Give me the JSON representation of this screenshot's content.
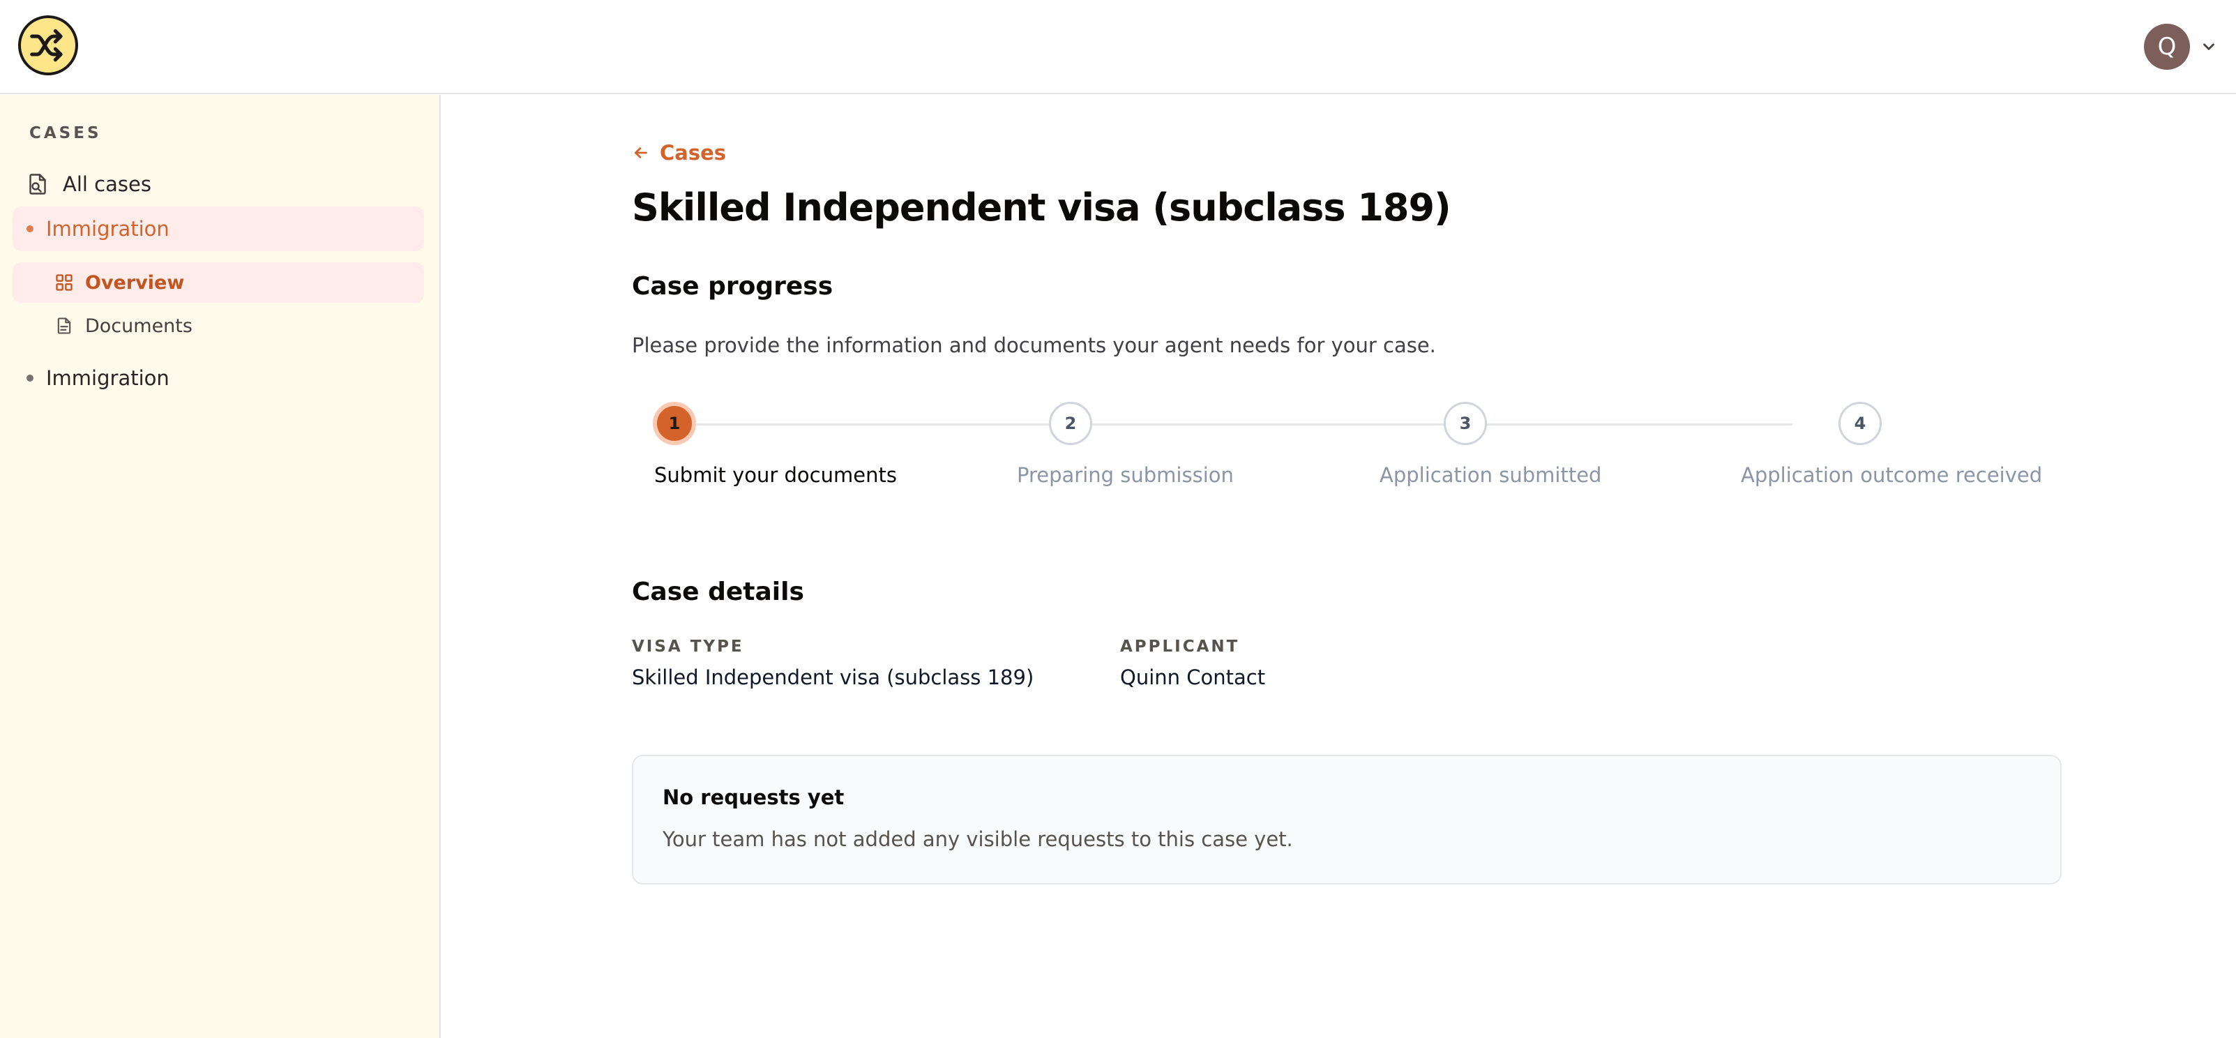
{
  "header": {
    "logo_icon": "shuffle-icon",
    "avatar_initial": "Q",
    "menu_icon": "chevron-down-icon"
  },
  "sidebar": {
    "heading": "CASES",
    "all_cases": {
      "label": "All cases",
      "icon": "document-search-icon"
    },
    "case_1": {
      "label": "Immigration",
      "active": true
    },
    "sub_items": [
      {
        "label": "Overview",
        "icon": "grid-icon",
        "active": true
      },
      {
        "label": "Documents",
        "icon": "file-icon",
        "active": false
      }
    ],
    "case_2": {
      "label": "Immigration",
      "active": false
    }
  },
  "main": {
    "back_label": "Cases",
    "title": "Skilled Independent visa (subclass 189)",
    "progress_heading": "Case progress",
    "intro": "Please provide the information and documents your agent needs for your case.",
    "steps": [
      {
        "number": "1",
        "label": "Submit your documents",
        "status": "current"
      },
      {
        "number": "2",
        "label": "Preparing submission",
        "status": "upcoming"
      },
      {
        "number": "3",
        "label": "Application submitted",
        "status": "upcoming"
      },
      {
        "number": "4",
        "label": "Application outcome received",
        "status": "upcoming"
      }
    ],
    "details_heading": "Case details",
    "details": [
      {
        "label": "VISA TYPE",
        "value": "Skilled Independent visa (subclass 189)"
      },
      {
        "label": "APPLICANT",
        "value": "Quinn Contact"
      }
    ],
    "empty_state": {
      "title": "No requests yet",
      "body": "Your team has not added any visible requests to this case yet."
    }
  },
  "colors": {
    "accent": "#d4622b",
    "sidebar_bg": "#fffaeb",
    "active_item_bg": "#fdecea",
    "avatar_bg": "#7c5f5a"
  }
}
